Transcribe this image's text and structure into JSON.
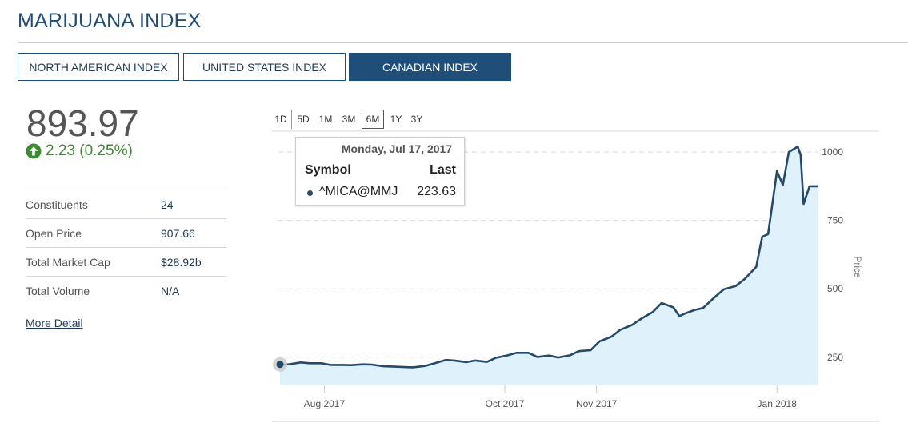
{
  "page": {
    "title": "MARIJUANA INDEX"
  },
  "tabs": [
    {
      "label": "NORTH AMERICAN INDEX",
      "active": false
    },
    {
      "label": "UNITED STATES INDEX",
      "active": false
    },
    {
      "label": "CANADIAN INDEX",
      "active": true
    }
  ],
  "quote": {
    "price": "893.97",
    "change": "2.23 (0.25%)",
    "direction": "up",
    "up_color": "#3a8c2f"
  },
  "stats": [
    {
      "label": "Constituents",
      "value": "24"
    },
    {
      "label": "Open Price",
      "value": "907.66"
    },
    {
      "label": "Total Market Cap",
      "value": "$28.92b"
    },
    {
      "label": "Total Volume",
      "value": "N/A"
    }
  ],
  "more_detail": "More Detail",
  "ranges": [
    {
      "label": "1D",
      "active": false
    },
    {
      "label": "5D",
      "active": false
    },
    {
      "label": "1M",
      "active": false
    },
    {
      "label": "3M",
      "active": false
    },
    {
      "label": "6M",
      "active": true
    },
    {
      "label": "1Y",
      "active": false
    },
    {
      "label": "3Y",
      "active": false
    }
  ],
  "tooltip": {
    "date": "Monday, Jul 17, 2017",
    "symbol_header": "Symbol",
    "last_header": "Last",
    "symbol": "^MICA@MMJ",
    "last": "223.63"
  },
  "chart_data": {
    "type": "area",
    "title": "",
    "xlabel": "",
    "ylabel": "Price",
    "y_axis_position": "right",
    "grid": "horizontal dashed",
    "ylim": [
      150,
      1050
    ],
    "yticks": [
      250,
      500,
      750,
      1000
    ],
    "xticks": [
      "Aug 2017",
      "Oct 2017",
      "Nov 2017",
      "Jan 2018"
    ],
    "xtick_dates": [
      "2017-08-01",
      "2017-10-01",
      "2017-11-01",
      "2018-01-01"
    ],
    "line_color": "#234a6c",
    "fill_color": "#dff1fb",
    "series": [
      {
        "x": [
          "2017-07-17",
          "2017-07-20",
          "2017-07-24",
          "2017-07-27",
          "2017-07-31",
          "2017-08-03",
          "2017-08-07",
          "2017-08-10",
          "2017-08-14",
          "2017-08-17",
          "2017-08-21",
          "2017-08-24",
          "2017-08-28",
          "2017-08-31",
          "2017-09-04",
          "2017-09-07",
          "2017-09-11",
          "2017-09-14",
          "2017-09-18",
          "2017-09-21",
          "2017-09-25",
          "2017-09-28",
          "2017-10-02",
          "2017-10-05",
          "2017-10-09",
          "2017-10-12",
          "2017-10-16",
          "2017-10-19",
          "2017-10-23",
          "2017-10-26",
          "2017-10-30",
          "2017-11-02",
          "2017-11-06",
          "2017-11-09",
          "2017-11-13",
          "2017-11-16",
          "2017-11-20",
          "2017-11-23",
          "2017-11-27",
          "2017-11-29",
          "2017-12-01",
          "2017-12-04",
          "2017-12-07",
          "2017-12-11",
          "2017-12-14",
          "2017-12-18",
          "2017-12-21",
          "2017-12-25",
          "2017-12-27",
          "2017-12-29",
          "2018-01-01",
          "2018-01-03",
          "2018-01-05",
          "2018-01-08",
          "2018-01-09",
          "2018-01-10",
          "2018-01-12",
          "2018-01-15"
        ],
        "values": [
          223.63,
          224,
          231,
          228,
          228,
          222,
          222,
          221,
          224,
          223,
          217,
          216,
          214,
          213,
          218,
          227,
          240,
          238,
          232,
          238,
          233,
          248,
          257,
          266,
          266,
          251,
          256,
          249,
          257,
          272,
          276,
          308,
          325,
          350,
          368,
          390,
          415,
          448,
          432,
          400,
          410,
          422,
          430,
          470,
          498,
          510,
          535,
          580,
          690,
          700,
          930,
          880,
          1000,
          1020,
          990,
          810,
          875,
          875
        ]
      }
    ]
  }
}
